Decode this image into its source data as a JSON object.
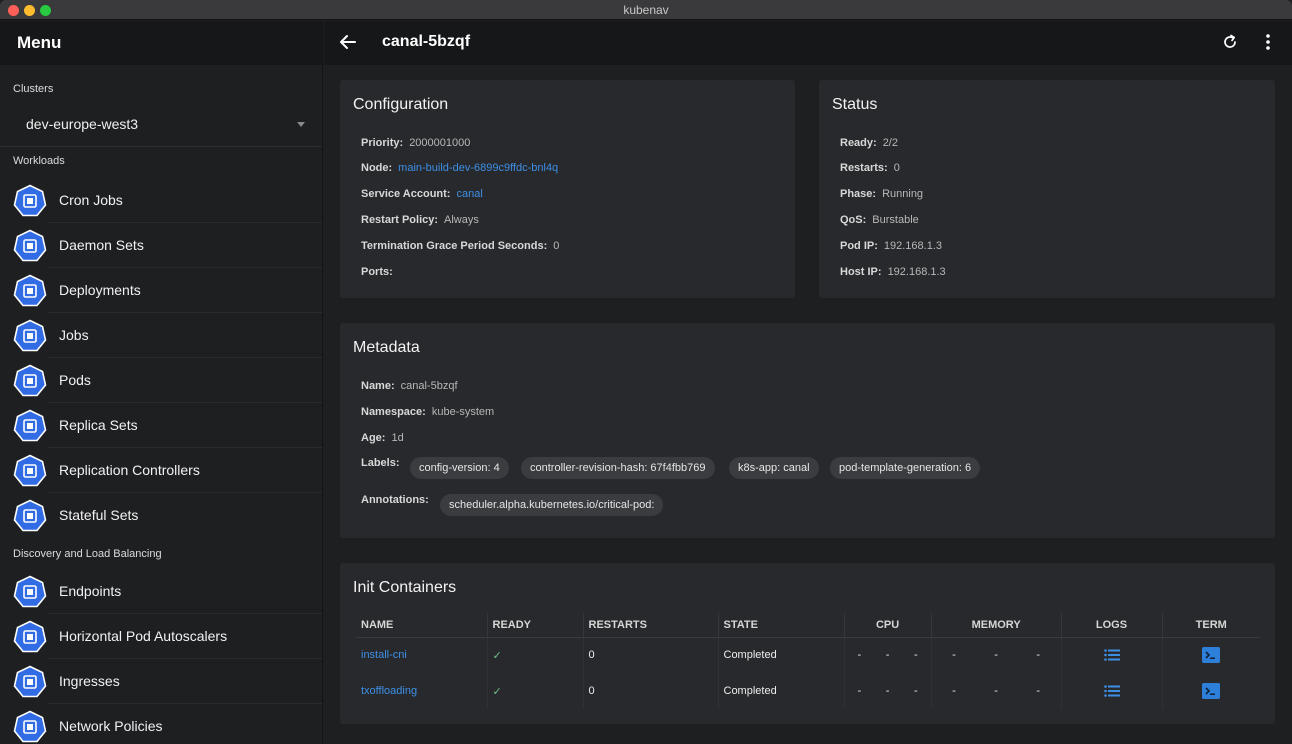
{
  "window": {
    "title": "kubenav"
  },
  "sidebar": {
    "menu_title": "Menu",
    "clusters_label": "Clusters",
    "selected_cluster": "dev-europe-west3",
    "workloads_label": "Workloads",
    "workloads": [
      {
        "label": "Cron Jobs",
        "icon": "cronjob-icon"
      },
      {
        "label": "Daemon Sets",
        "icon": "daemonset-icon"
      },
      {
        "label": "Deployments",
        "icon": "deployment-icon"
      },
      {
        "label": "Jobs",
        "icon": "job-icon"
      },
      {
        "label": "Pods",
        "icon": "pod-icon"
      },
      {
        "label": "Replica Sets",
        "icon": "replicaset-icon"
      },
      {
        "label": "Replication Controllers",
        "icon": "replication-controller-icon"
      },
      {
        "label": "Stateful Sets",
        "icon": "statefulset-icon"
      }
    ],
    "discovery_label": "Discovery and Load Balancing",
    "discovery": [
      {
        "label": "Endpoints",
        "icon": "endpoints-icon"
      },
      {
        "label": "Horizontal Pod Autoscalers",
        "icon": "hpa-icon"
      },
      {
        "label": "Ingresses",
        "icon": "ingress-icon"
      },
      {
        "label": "Network Policies",
        "icon": "network-policy-icon"
      }
    ]
  },
  "toolbar": {
    "title": "canal-5bzqf"
  },
  "configuration": {
    "title": "Configuration",
    "priority_label": "Priority:",
    "priority": "2000001000",
    "node_label": "Node:",
    "node": "main-build-dev-6899c9ffdc-bnl4q",
    "service_account_label": "Service Account:",
    "service_account": "canal",
    "restart_policy_label": "Restart Policy:",
    "restart_policy": "Always",
    "termination_label": "Termination Grace Period Seconds:",
    "termination": "0",
    "ports_label": "Ports:"
  },
  "status": {
    "title": "Status",
    "ready_label": "Ready:",
    "ready": "2/2",
    "restarts_label": "Restarts:",
    "restarts": "0",
    "phase_label": "Phase:",
    "phase": "Running",
    "qos_label": "QoS:",
    "qos": "Burstable",
    "pod_ip_label": "Pod IP:",
    "pod_ip": "192.168.1.3",
    "host_ip_label": "Host IP:",
    "host_ip": "192.168.1.3"
  },
  "metadata": {
    "title": "Metadata",
    "name_label": "Name:",
    "name": "canal-5bzqf",
    "namespace_label": "Namespace:",
    "namespace": "kube-system",
    "age_label": "Age:",
    "age": "1d",
    "labels_label": "Labels:",
    "labels": [
      "config-version: 4",
      "controller-revision-hash: 67f4fbb769",
      "k8s-app: canal",
      "pod-template-generation: 6"
    ],
    "annotations_label": "Annotations:",
    "annotations": [
      "scheduler.alpha.kubernetes.io/critical-pod:"
    ]
  },
  "init_containers": {
    "title": "Init Containers",
    "headers": {
      "name": "NAME",
      "ready": "READY",
      "restarts": "RESTARTS",
      "state": "STATE",
      "cpu": "CPU",
      "memory": "MEMORY",
      "logs": "LOGS",
      "term": "TERM"
    },
    "rows": [
      {
        "name": "install-cni",
        "ready": "✓",
        "restarts": "0",
        "state": "Completed",
        "cpu": [
          "-",
          "-",
          "-"
        ],
        "memory": [
          "-",
          "-",
          "-"
        ]
      },
      {
        "name": "txoffloading",
        "ready": "✓",
        "restarts": "0",
        "state": "Completed",
        "cpu": [
          "-",
          "-",
          "-"
        ],
        "memory": [
          "-",
          "-",
          "-"
        ]
      }
    ]
  },
  "colors": {
    "accent": "#3d8fe6",
    "k8s_blue": "#326ce5",
    "check": "#6fc18a"
  }
}
